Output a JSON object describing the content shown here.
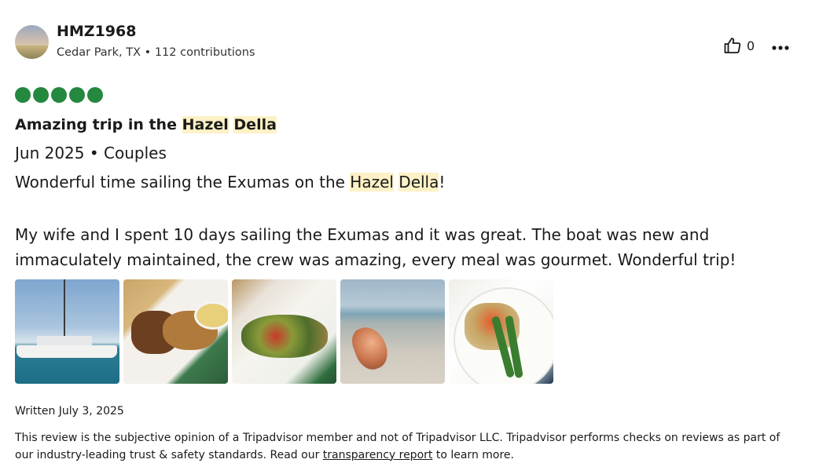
{
  "reviewer": {
    "username": "HMZ1968",
    "location_contributions": "Cedar Park, TX • 112 contributions"
  },
  "actions": {
    "helpful_count": "0",
    "helpful_icon": "thumbs-up-icon",
    "more_icon": "more-horizontal-icon"
  },
  "rating": {
    "value": 5,
    "max": 5,
    "color": "#24883f"
  },
  "review": {
    "title_prefix": "Amazing trip in the ",
    "title_highlight_1": "Hazel",
    "title_highlight_2": "Della",
    "trip_meta": "Jun 2025 • Couples",
    "body1_prefix": "Wonderful time sailing the Exumas on the ",
    "body1_highlight_1": "Hazel",
    "body1_highlight_2": "Della",
    "body1_suffix": "!",
    "body2": "My wife and I spent 10 days sailing the Exumas and it was great. The boat was new and immaculately maintained, the crew was amazing, every meal was gourmet. Wonderful trip!",
    "highlight_color": "#fdf1c5"
  },
  "photos": [
    {
      "subject": "catamaran-photo"
    },
    {
      "subject": "food-plate-photo"
    },
    {
      "subject": "salad-photo"
    },
    {
      "subject": "conch-shell-beach-photo"
    },
    {
      "subject": "plated-dish-photo"
    }
  ],
  "footer": {
    "written": "Written July 3, 2025",
    "disclaimer_prefix": "This review is the subjective opinion of a Tripadvisor member and not of Tripadvisor LLC. Tripadvisor performs checks on reviews as part of our industry-leading trust & safety standards. Read our ",
    "disclaimer_link": "transparency report",
    "disclaimer_suffix": " to learn more."
  }
}
